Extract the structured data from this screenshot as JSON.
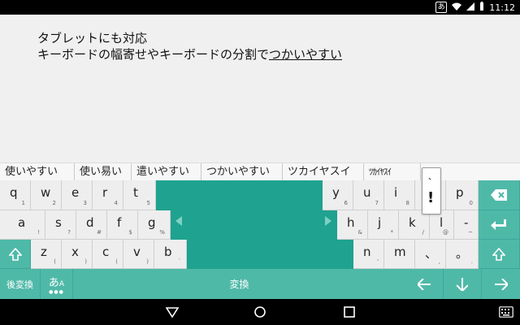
{
  "status_bar": {
    "ime_indicator": "あ",
    "time": "11:12",
    "icons": [
      "ime-badge-icon",
      "wifi-icon",
      "signal-icon",
      "battery-icon"
    ]
  },
  "editor": {
    "line1": "タブレットにも対応",
    "line2_prefix": "キーボードの幅寄せやキーボードの分割で",
    "line2_underlined": "つかいやすい"
  },
  "candidates": [
    "使いやすい",
    "使い易い",
    "遣いやすい",
    "つかいやすい",
    "ツカイヤスイ",
    "ﾂｶｲﾔｽｲ"
  ],
  "keyboard": {
    "row1_left": [
      {
        "main": "q",
        "sub": "1"
      },
      {
        "main": "w",
        "sub": "2"
      },
      {
        "main": "e",
        "sub": "3"
      },
      {
        "main": "r",
        "sub": "4"
      },
      {
        "main": "t",
        "sub": "5"
      }
    ],
    "row1_right": [
      {
        "main": "y",
        "sub": "6"
      },
      {
        "main": "u",
        "sub": "7"
      },
      {
        "main": "i",
        "sub": "8"
      },
      {
        "main": "",
        "sub": "9"
      },
      {
        "main": "p",
        "sub": "0"
      }
    ],
    "row2_left": [
      {
        "main": "a",
        "sub": "!"
      },
      {
        "main": "s",
        "sub": "?"
      },
      {
        "main": "d",
        "sub": "#"
      },
      {
        "main": "f",
        "sub": "$"
      },
      {
        "main": "g",
        "sub": "%"
      }
    ],
    "row2_right": [
      {
        "main": "h",
        "sub": "&"
      },
      {
        "main": "j",
        "sub": "*"
      },
      {
        "main": "k",
        "sub": "/"
      },
      {
        "main": "l",
        "sub": "@"
      },
      {
        "main": "-",
        "sub": "~"
      }
    ],
    "row3_left": [
      {
        "main": "z",
        "sub": "("
      },
      {
        "main": "x",
        "sub": ")"
      },
      {
        "main": "c",
        "sub": "("
      },
      {
        "main": "v",
        "sub": ")"
      },
      {
        "main": "b",
        "sub": "`"
      }
    ],
    "row3_right": [
      {
        "main": "n",
        "sub": "'"
      },
      {
        "main": "m",
        "sub": ""
      },
      {
        "main": "、",
        "sub": ","
      },
      {
        "main": "。",
        "sub": "."
      }
    ],
    "bottom": {
      "undo": "後変換",
      "mode_main": "あ",
      "mode_sub": "A",
      "space": "変換"
    },
    "popup": {
      "top": "、",
      "main": "!"
    }
  }
}
